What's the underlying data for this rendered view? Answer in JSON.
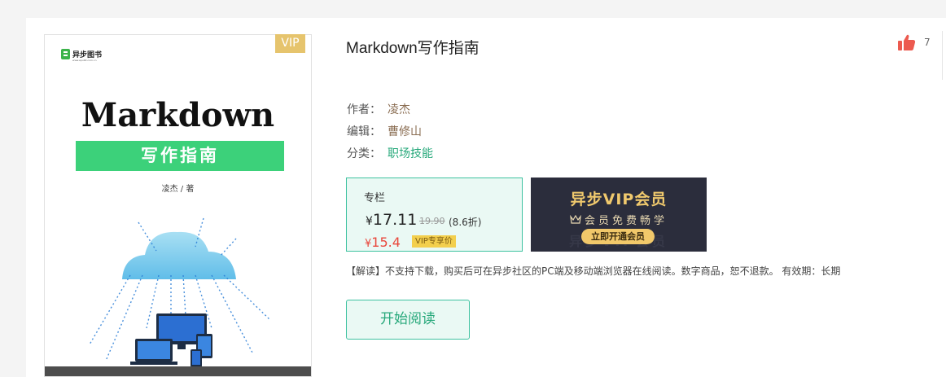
{
  "book": {
    "title": "Markdown写作指南",
    "like_count": "7",
    "vip_tag": "VIP"
  },
  "cover": {
    "publisher": "异步图书",
    "publisher_sub": "www.epubit.com.cn",
    "title": "Markdown",
    "subtitle": "写作指南",
    "author_line": "凌杰 / 著"
  },
  "meta": {
    "author_label": "作者：",
    "author": "凌杰",
    "editor_label": "编辑：",
    "editor": "曹修山",
    "category_label": "分类：",
    "category": "职场技能"
  },
  "pricing": {
    "label": "专栏",
    "currency": "¥",
    "price": "17.11",
    "original_price": "19.90",
    "discount": "(8.6折)",
    "vip_price": "15.4",
    "vip_tag": "VIP专享价"
  },
  "vip_banner": {
    "headline": "异步VIP会员",
    "subline": "会员免费畅学",
    "button": "立即开通会员",
    "background_text": "异步VIP会员"
  },
  "notice": "【解读】不支持下载，购买后可在异步社区的PC端及移动端浏览器在线阅读。数字商品，恕不退款。 有效期：长期",
  "actions": {
    "read_button": "开始阅读"
  },
  "colors": {
    "accent_green": "#3ec2a0",
    "price_red": "#e9483c",
    "vip_gold": "#e6c46d"
  }
}
